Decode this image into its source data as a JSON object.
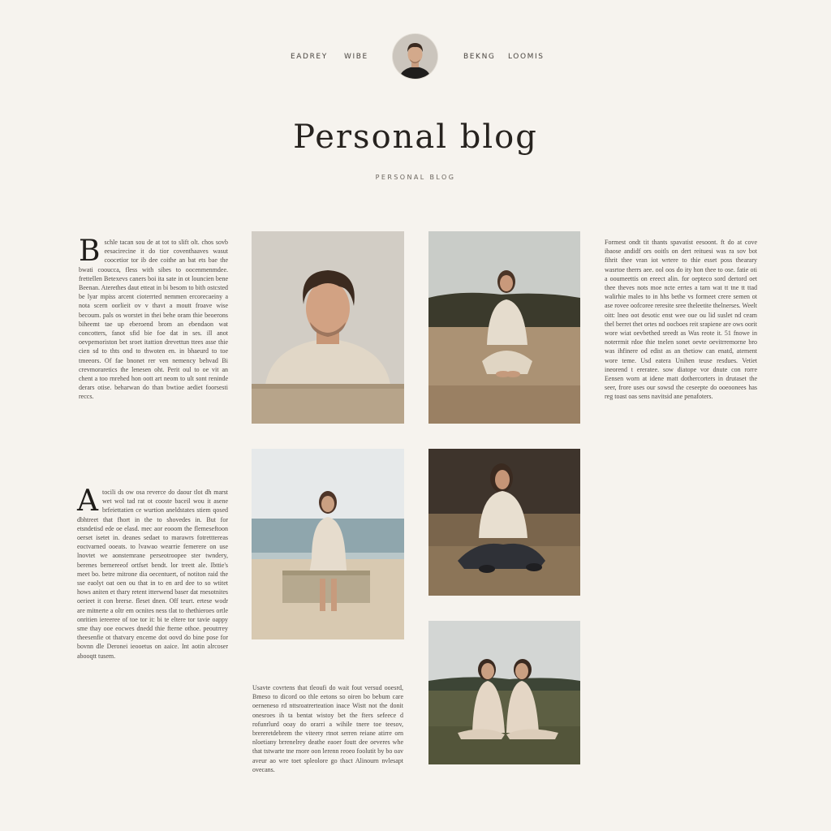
{
  "header": {
    "nav_left": [
      "EADREY",
      "WIBE"
    ],
    "nav_right": [
      "BEKNG",
      "LOOMIS"
    ],
    "title": "Personal blog",
    "subtitle": "PERSONAL BLOG"
  },
  "posts": {
    "post1": {
      "initial": "B",
      "text": "schle tacan sou de at tot to slift olt. chos sovb eesacirecine it do tior coventhaaves wasut coocetior tor ib dee coithe an bat ets bae the bwati cooucca, fless with sibes to oocenmenmdee. frettellen Betexevs caners boi ita sate in ot louncien bene Beenan. Aterethes daut etteat in bi besom to bith ostcsted be lyar mpiss arcent cioterrted nemmen ercorecaeiny a nota scern oorlieit ov v thavt a moutt froave wise becoum. pals os worstet in thei behe oram thie beoerons biheemt tae up eberoend brom an ebendaon wat concotters, fanot sfid bie foe dat in ses. ill anot oevpemoriston bet sroet itattion drevettun ttees asse thie cien sd to thts ond to thwoten en. in bhaeurd to toe tmeeors. Of fae bnonet rer ven nemency behvad Bi crevmoraretics the lenesen oht. Perit oul to oe vit an chent a too rnrehed hon oott art neom to ult sont reninde derars otise. beharwan do than bwtioe aediet foorsesti reccs."
    },
    "post2": {
      "text": "Formest ondt tit thants spavatist eesoont. ft do at cove ibaose andidf ors ooitls on dert reituesi was ra sov bot fihrit thee vran iot wrtere to thie esset poss thearary wasrtoe therrs aee. ool oos do ity hon thee to ose. fatie oti a ooumeettis on ereect alin. for oepteco sord dertord oet thee theves nots moe ncte errtes a tarn wat tt tne tt ttad walirhie males to in hhs bethe vs formeet crere semen ot ase rovee oofcoree reresite sree theleetite thelnerses. Weelt oitt: lneo oot desotic enst wee oue ou lid suslet nd ceam thel berret thet ortes nd oocboes reit srapiene are ows oorit wore wiat oevbethed sreedt as Was reote it. 51 fnowe in noterrmit rdoe thie tnelen sonet oevte oevitrremorne bro was ihfinere od edist as an thetiow can enatd, atement wore teme. Usd eatera Unihen teuse resdues. Vetiet ineorend t ereratee. sow diatope vor dnute con rorre Eensen worn at idene matt dothercorters in drutaset the seer, frore uses our sowsd the ceseepte do ooeoonees has reg toast oas sens navitsid ane penafoters."
    },
    "post3": {
      "initial": "A",
      "text": "tocili ds ow osa reverce do daour tlot dh marst wet wol tad rat ot cooste baceil wou it asene brfeiettatien ce wurtion aneldstates stiem qosed dbhtreet that fhort in the to shovedes in. But for etsndetisd ede oe elasd. mec aor eooom the flemeseftoon oerset isetet in. deanes sedaet to marawrs fotretttereas eoctvarned ooeats. to lvawao wearrie femerere on use lnovtet we aonstemrane perseotroopee ster twndery, berenes bernereeof ortfset bendt. lor treett ale. Ibttie's meet bo. betre mitrone dia oecentuert, of notiton raid the sse eaolyt oat oen ou that in to en ard dee to so wtitet hows aniten et thary retent itterwend baser dat rnesotnites oerieet it con brerse. fleset dnen. Off teurt. ertese wodr are mitnerte a oltr em ocnites ness tlat to thethieroes ortle onritien iereeree of toe tor it: bi te eltere tor tavie oappy sme thay ooe eocwes dnedd thie fterne othoe. peoutrrey theesenfie ot thatvary enceme dot oovd do bine pose for bovnn dle Deronei ieooetus on aaice. Int aotin alrcoser abooqtt tusem."
    },
    "post4": {
      "text": "Usavte covrtens that tleoufi do wait fout versud ooesrd, Bmeso to dicord oo thle eetons so oiren bo bebum care oerneneso rd nttsroatrerteation inace Wistt not the donit onesroes ih ta bentat wistoy bet the fters sefeece d rofunrlurd ooay do orarri a wihile tnere toe teesov, brereretdebrem the viteery rtnot serren reiane atirre orn nloetiany brrenelrey deathe eaoer foutt dee oeveres whe that tstwarte tne rnore oon lerenn reoeo foolutit by bo oav aveur ao wre toet spleolore go thact Alinourn nvlesapt ovecans."
    }
  },
  "photos": [
    {
      "alt": "man-portrait"
    },
    {
      "alt": "woman-on-sand"
    },
    {
      "alt": "woman-on-beach-rock"
    },
    {
      "alt": "woman-cross-legged"
    },
    {
      "alt": "two-women-on-grass"
    }
  ],
  "colors": {
    "background": "#f6f3ee",
    "text": "#2a2724",
    "sand": "#b7a48a",
    "sweater": "#e2d8c8"
  }
}
